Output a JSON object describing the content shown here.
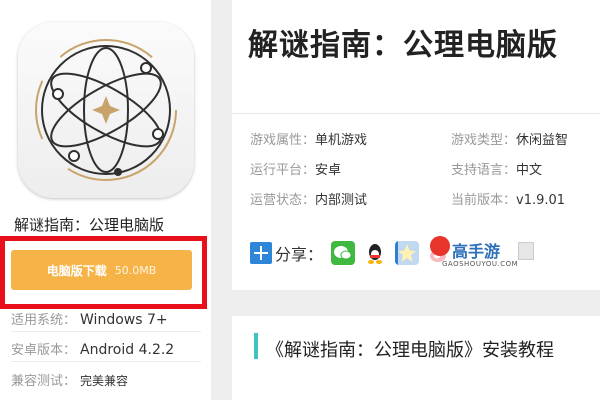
{
  "app": {
    "name": "解谜指南：公理电脑版",
    "icon": "atom-compass-icon"
  },
  "download": {
    "label": "电脑版下载",
    "size": "50.0MB"
  },
  "meta": [
    {
      "key": "适用系统：",
      "value": "Windows 7+"
    },
    {
      "key": "安卓版本：",
      "value": "Android 4.2.2"
    },
    {
      "key": "兼容测试：",
      "value": "完美兼容"
    }
  ],
  "header": {
    "title": "解谜指南：公理电脑版"
  },
  "attributes": [
    {
      "key": "游戏属性：",
      "value": "单机游戏"
    },
    {
      "key": "游戏类型：",
      "value": "休闲益智"
    },
    {
      "key": "运行平台：",
      "value": "安卓"
    },
    {
      "key": "支持语言：",
      "value": "中文"
    },
    {
      "key": "运营状态：",
      "value": "内部测试"
    },
    {
      "key": "当前版本：",
      "value": "v1.9.01"
    }
  ],
  "share": {
    "label": "分享：",
    "icons": [
      "wechat-icon",
      "qq-icon",
      "qzone-icon",
      "weibo-icon",
      "copy-icon"
    ]
  },
  "watermark": {
    "name": "高手游",
    "domain": "GAOSHOUYOU.COM"
  },
  "tutorial": {
    "title": "《解谜指南：公理电脑版》安装教程"
  },
  "colors": {
    "download_button": "#f6b347",
    "highlight_border": "#e8101a",
    "accent_bar": "#3ec3c3"
  }
}
